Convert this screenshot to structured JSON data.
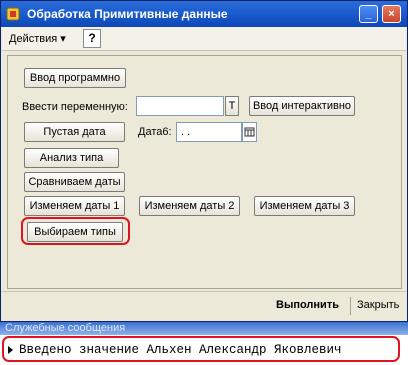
{
  "window": {
    "title": "Обработка  Примитивные данные"
  },
  "toolbar": {
    "actions_label": "Действия ▾",
    "help_label": "?"
  },
  "form": {
    "btn_input_program": "Ввод программно",
    "label_enter_var": "Ввести переменную:",
    "var_value": "",
    "t_button": "T",
    "btn_input_interactive": "Ввод интерактивно",
    "btn_empty_date": "Пустая дата",
    "label_date6": "Дата6:",
    "date6_value": " .  .",
    "btn_type_analysis": "Анализ типа",
    "btn_compare_dates": "Сравниваем даты",
    "btn_change_dates_1": "Изменяем даты 1",
    "btn_change_dates_2": "Изменяем даты 2",
    "btn_change_dates_3": "Изменяем даты 3",
    "btn_choose_types": "Выбираем типы"
  },
  "bottom": {
    "run_label": "Выполнить",
    "close_label": "Закрыть"
  },
  "messages": {
    "header": "Служебные сообщения",
    "items": [
      {
        "text": "Введено значение Альхен Александр Яковлевич"
      }
    ]
  },
  "colors": {
    "highlight": "#e0141e",
    "title_bar": "#1d5fd1"
  }
}
